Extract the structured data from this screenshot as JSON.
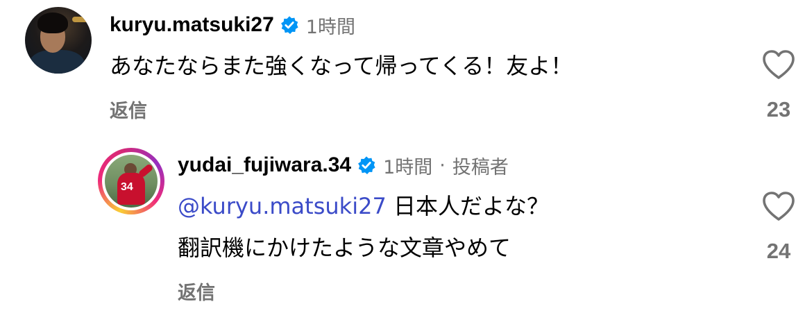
{
  "comments": [
    {
      "username": "kuryu.matsuki27",
      "verified": true,
      "time": "1時間",
      "text": "あなたならまた強くなって帰ってくる！友よ！",
      "reply_label": "返信",
      "like_count": "23",
      "icons": {
        "avatar": "avatar",
        "verified": "verified-badge-icon",
        "like": "heart-icon"
      }
    },
    {
      "username": "yudai_fujiwara.34",
      "verified": true,
      "time": "1時間",
      "separator": "·",
      "author_tag": "投稿者",
      "mention": "@kuryu.matsuki27",
      "text_line1": " 日本人だよな？",
      "text_line2": "翻訳機にかけたような文章やめて",
      "reply_label": "返信",
      "like_count": "24",
      "jersey_number": "34",
      "icons": {
        "avatar": "avatar",
        "verified": "verified-badge-icon",
        "like": "heart-icon"
      }
    }
  ],
  "colors": {
    "verified_blue": "#0095f6",
    "mention_blue": "#3b4bc8",
    "secondary_text": "#737373"
  }
}
